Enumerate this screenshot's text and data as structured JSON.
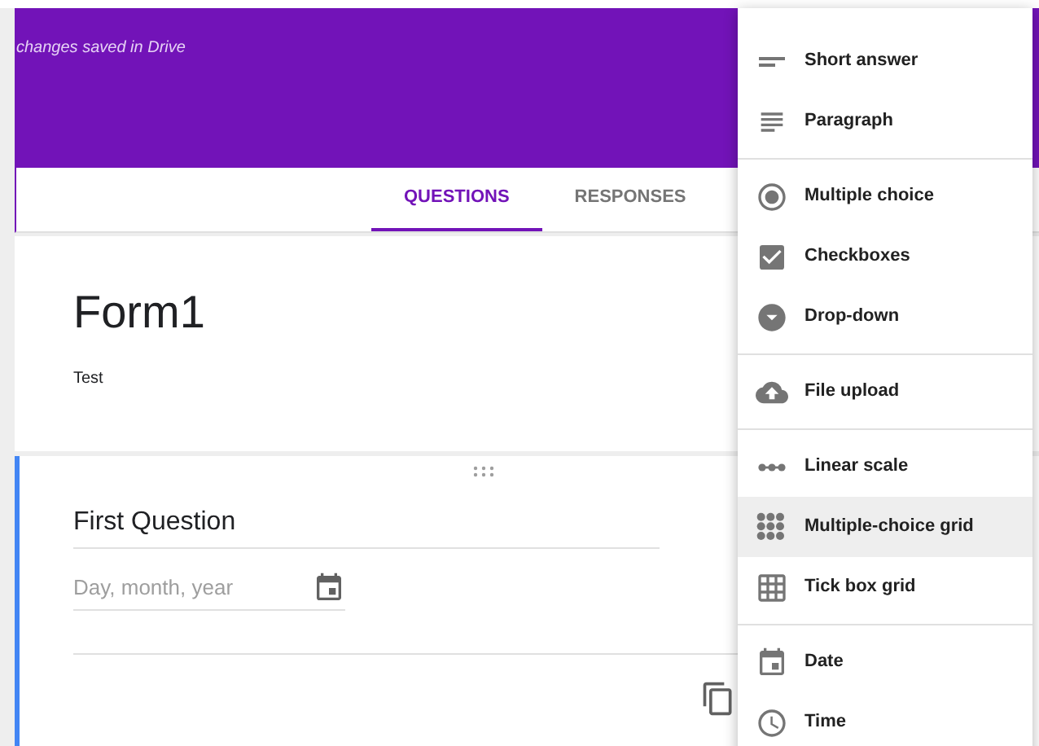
{
  "header": {
    "status": "changes saved in Drive"
  },
  "tabs": [
    {
      "label": "QUESTIONS",
      "selected": true
    },
    {
      "label": "RESPONSES",
      "selected": false
    }
  ],
  "form": {
    "title": "Form1",
    "description": "Test"
  },
  "question": {
    "title": "First Question",
    "placeholder": "Day, month, year"
  },
  "menu": {
    "groups": [
      {
        "items": [
          {
            "label": "Short answer",
            "selected": false
          },
          {
            "label": "Paragraph",
            "selected": false
          }
        ]
      },
      {
        "items": [
          {
            "label": "Multiple choice",
            "selected": false
          },
          {
            "label": "Checkboxes",
            "selected": false
          },
          {
            "label": "Drop-down",
            "selected": false
          }
        ]
      },
      {
        "items": [
          {
            "label": "File upload",
            "selected": false
          }
        ]
      },
      {
        "items": [
          {
            "label": "Linear scale",
            "selected": false
          },
          {
            "label": "Multiple-choice grid",
            "selected": true
          },
          {
            "label": "Tick box grid",
            "selected": false
          }
        ]
      },
      {
        "items": [
          {
            "label": "Date",
            "selected": false
          },
          {
            "label": "Time",
            "selected": false
          }
        ]
      }
    ]
  }
}
